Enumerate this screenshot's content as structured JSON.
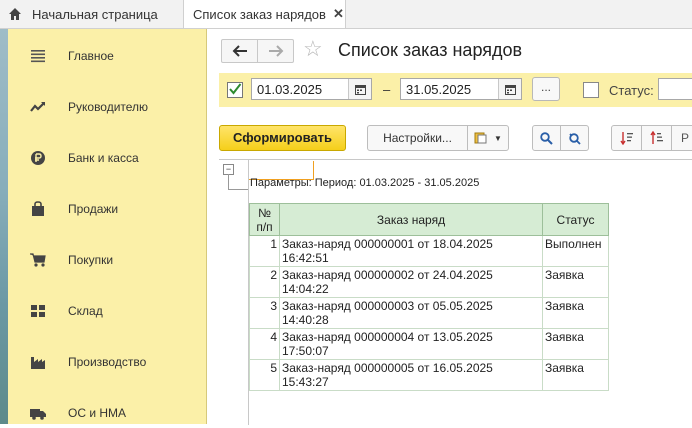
{
  "tabs": {
    "home_label": "Начальная страница",
    "active_label": "Список заказ нарядов"
  },
  "sidebar": {
    "items": [
      {
        "label": "Главное",
        "icon": "menu-icon"
      },
      {
        "label": "Руководителю",
        "icon": "trend-chart-icon"
      },
      {
        "label": "Банк и касса",
        "icon": "ruble-coin-icon"
      },
      {
        "label": "Продажи",
        "icon": "shopping-bag-icon"
      },
      {
        "label": "Покупки",
        "icon": "cart-icon"
      },
      {
        "label": "Склад",
        "icon": "warehouse-grid-icon"
      },
      {
        "label": "Производство",
        "icon": "factory-icon"
      },
      {
        "label": "ОС и НМА",
        "icon": "truck-icon"
      }
    ]
  },
  "main": {
    "title": "Список заказ нарядов",
    "filters": {
      "date_from": "01.03.2025",
      "date_to": "31.05.2025",
      "dash": "–",
      "dots_label": "...",
      "status_label": "Статус:",
      "status_value": ""
    },
    "toolbar": {
      "generate_label": "Сформировать",
      "settings_label": "Настройки..."
    },
    "report": {
      "params_text": "Параметры: Период: 01.03.2025 - 31.05.2025",
      "columns": {
        "num": "№ п/п",
        "num_line1": "№",
        "num_line2": "п/п",
        "order": "Заказ наряд",
        "status": "Статус"
      },
      "rows": [
        {
          "num": "1",
          "order_line1": "Заказ-наряд 000000001 от 18.04.2025",
          "order_line2": "16:42:51",
          "status": "Выполнен"
        },
        {
          "num": "2",
          "order_line1": "Заказ-наряд 000000002 от 24.04.2025",
          "order_line2": "14:04:22",
          "status": "Заявка"
        },
        {
          "num": "3",
          "order_line1": "Заказ-наряд 000000003 от 05.05.2025",
          "order_line2": "14:40:28",
          "status": "Заявка"
        },
        {
          "num": "4",
          "order_line1": "Заказ-наряд 000000004 от 13.05.2025",
          "order_line2": "17:50:07",
          "status": "Заявка"
        },
        {
          "num": "5",
          "order_line1": "Заказ-наряд 000000005 от 16.05.2025",
          "order_line2": "15:43:27",
          "status": "Заявка"
        }
      ]
    }
  },
  "colors": {
    "sidebar_bg": "#fbf0a8",
    "primary_button": "#f5cf1a",
    "table_header": "#d6ecd4",
    "checkbox_check": "#2e8b2e"
  }
}
